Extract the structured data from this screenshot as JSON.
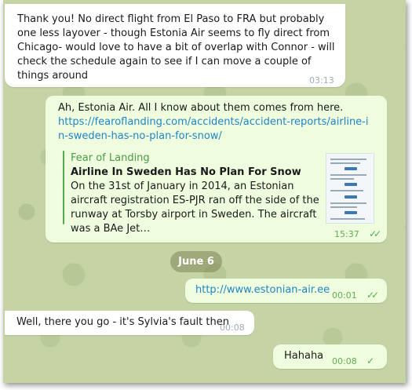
{
  "messages": [
    {
      "text": "Thank you! No direct flight from El Paso to FRA but probably one less layover - though Estonia  Air seems to fly direct from Chicago- would love to have a bit of overlap with Connor - will check the schedule again to see if I can move a couple of things around",
      "time": "03:13"
    },
    {
      "text": "Ah, Estonia Air. All I know about them comes from here.",
      "link": "https://fearoflanding.com/accidents/accident-reports/airline-in-sweden-has-no-plan-for-snow/",
      "preview": {
        "site": "Fear of Landing",
        "title": "Airline In Sweden Has No Plan For Snow",
        "description": "On the 31st of January in 2014, an Estonian aircraft registration ES-PJR ran off the side of the runway at Torsby airport in Sweden. The aircraft was a BAe Jet…"
      },
      "time": "15:37"
    },
    {
      "link": "http://www.estonian-air.ee",
      "time": "00:01"
    },
    {
      "text": "Well, there you go - it's Sylvia's fault then",
      "time": "00:08"
    },
    {
      "text": "Hahaha",
      "time": "00:08"
    }
  ],
  "date_separator": "June 6",
  "icons": {
    "read": "double-check-icon",
    "sent": "check-icon"
  },
  "colors": {
    "wallpaper": "#c5d3a5",
    "incoming_bubble": "#ffffff",
    "outgoing_bubble": "#effdde",
    "link": "#1f86c6",
    "accent": "#4fae4e"
  }
}
